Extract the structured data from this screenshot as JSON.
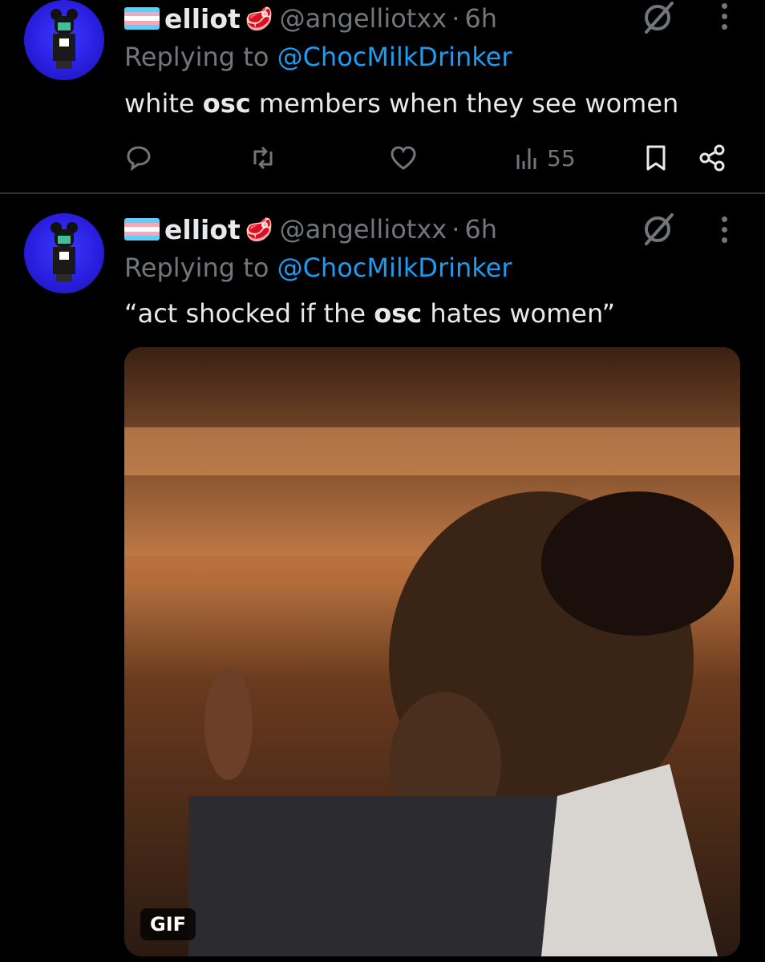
{
  "tweets": [
    {
      "display_name": "elliot",
      "handle": "@angelliotxx",
      "separator": "·",
      "time": "6h",
      "replying_prefix": "Replying to",
      "replying_to": "@ChocMilkDrinker",
      "text_before": "white ",
      "text_bold": "osc",
      "text_after": " members when they see women",
      "views": "55"
    },
    {
      "display_name": "elliot",
      "handle": "@angelliotxx",
      "separator": "·",
      "time": "6h",
      "replying_prefix": "Replying to",
      "replying_to": "@ChocMilkDrinker",
      "text_before": "“act shocked if the ",
      "text_bold": "osc",
      "text_after": " hates women”",
      "media_badge": "GIF"
    }
  ],
  "icons": {
    "flag": "transgender-flag-icon",
    "badge_emoji": "steak-emoji-icon",
    "grok": "grok-icon",
    "more": "more-options-icon",
    "reply": "reply-icon",
    "retweet": "retweet-icon",
    "like": "like-icon",
    "views": "views-icon",
    "bookmark": "bookmark-icon",
    "share": "share-icon"
  },
  "colors": {
    "background": "#000000",
    "text": "#e7e9ea",
    "muted": "#71767b",
    "link": "#1d9bf0"
  }
}
